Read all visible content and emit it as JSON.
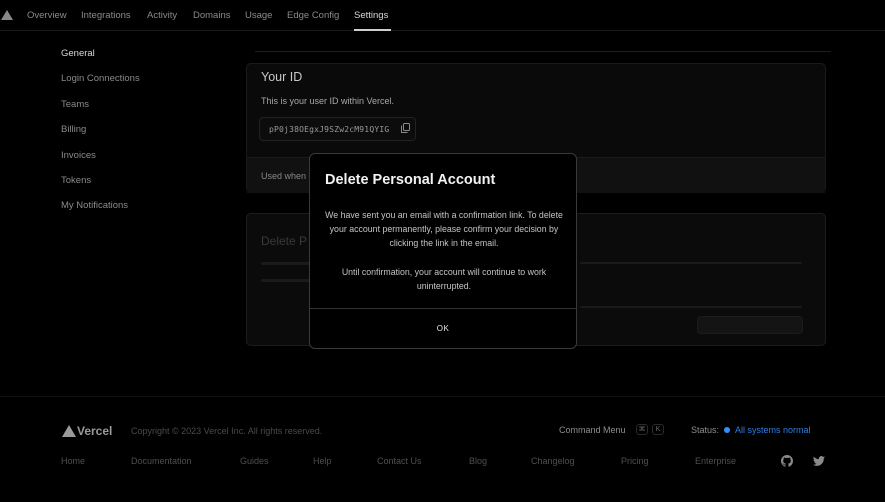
{
  "nav": {
    "tabs": [
      {
        "label": "Overview"
      },
      {
        "label": "Integrations"
      },
      {
        "label": "Activity"
      },
      {
        "label": "Domains"
      },
      {
        "label": "Usage"
      },
      {
        "label": "Edge Config"
      },
      {
        "label": "Settings",
        "active": true
      }
    ]
  },
  "sidebar": {
    "items": [
      {
        "label": "General",
        "active": true
      },
      {
        "label": "Login Connections"
      },
      {
        "label": "Teams"
      },
      {
        "label": "Billing"
      },
      {
        "label": "Invoices"
      },
      {
        "label": "Tokens"
      },
      {
        "label": "My Notifications"
      }
    ]
  },
  "user_id_card": {
    "title": "Your ID",
    "description": "This is your user ID within Vercel.",
    "id_value": "pP0j38OEgxJ9SZw2cM91QYIG",
    "footer_text": "Used when"
  },
  "danger_card": {
    "title": "Delete P"
  },
  "modal": {
    "title": "Delete Personal Account",
    "paragraph1": "We have sent you an email with a confirmation link. To delete your account permanently, please confirm your decision by clicking the link in the email.",
    "paragraph2": "Until confirmation, your account will continue to work uninterrupted.",
    "ok_label": "OK"
  },
  "footer": {
    "brand": "Vercel",
    "copyright": "Copyright © 2023 Vercel Inc. All rights reserved.",
    "command_menu_label": "Command Menu",
    "kbd_keys": [
      "⌘",
      "K"
    ],
    "status_label": "Status:",
    "status_text": "All systems normal",
    "status_color": "#3291ff",
    "links": [
      "Home",
      "Documentation",
      "Guides",
      "Help",
      "Contact Us",
      "Blog",
      "Changelog",
      "Pricing",
      "Enterprise"
    ],
    "icons": [
      "github-icon",
      "twitter-icon"
    ]
  }
}
